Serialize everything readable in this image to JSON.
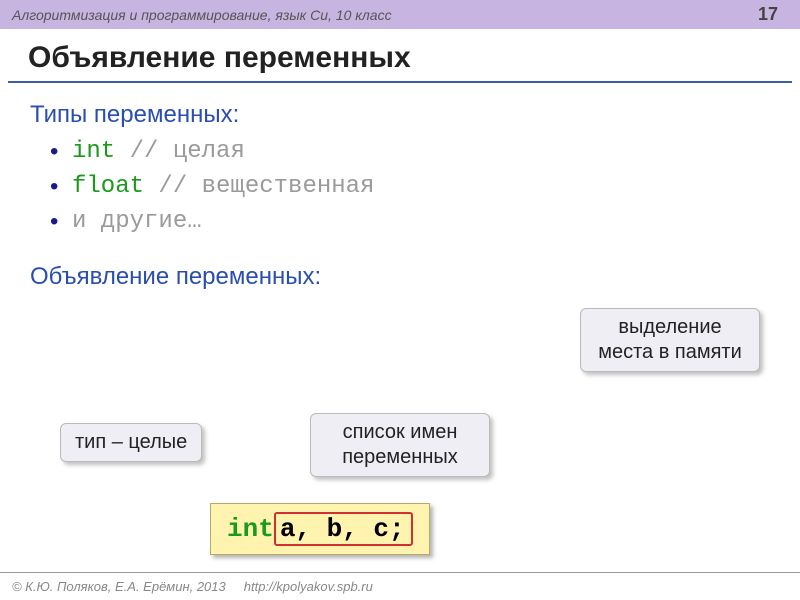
{
  "header": {
    "course": "Алгоритмизация и программирование, язык Си, 10 класс",
    "page": "17"
  },
  "title": "Объявление  переменных",
  "section_types": "Типы переменных:",
  "types": [
    {
      "kw": "int",
      "pad": "   ",
      "comment": "// целая"
    },
    {
      "kw": "float",
      "pad": "   ",
      "comment": "// вещественная"
    }
  ],
  "types_more": "и другие…",
  "section_decl": "Объявление переменных:",
  "callouts": {
    "mem": "выделение места в памяти",
    "type": "тип – целые",
    "list": "список имен переменных"
  },
  "code": {
    "kw": "int",
    "rest": " a, b, c;"
  },
  "footer": {
    "authors": "© К.Ю. Поляков, Е.А. Ерёмин, 2013",
    "url": "http://kpolyakov.spb.ru"
  }
}
